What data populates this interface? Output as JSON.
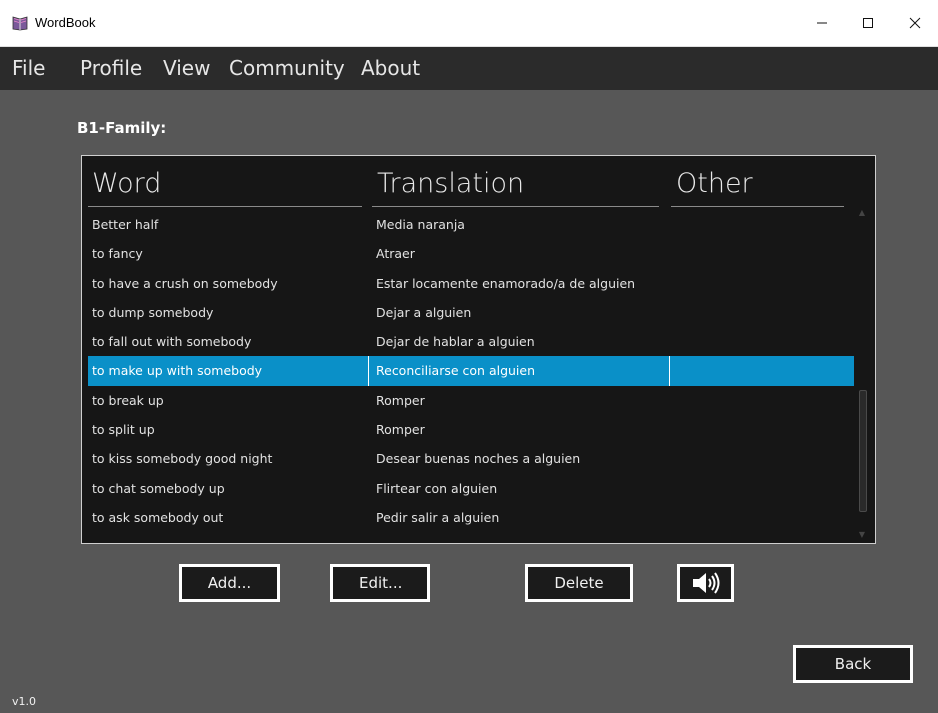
{
  "window": {
    "title": "WordBook",
    "app_icon": "book-icon",
    "controls": {
      "minimize": "minimize-icon",
      "maximize": "maximize-icon",
      "close": "close-icon"
    }
  },
  "menu": {
    "items": [
      {
        "label": "File"
      },
      {
        "label": "Profile"
      },
      {
        "label": "View"
      },
      {
        "label": "Community"
      },
      {
        "label": "About"
      }
    ]
  },
  "section": {
    "title": "B1-Family:"
  },
  "table": {
    "columns": [
      {
        "label": "Word"
      },
      {
        "label": "Translation"
      },
      {
        "label": "Other"
      }
    ],
    "rows": [
      {
        "word": "Better half",
        "translation": "Media naranja",
        "other": "",
        "selected": false
      },
      {
        "word": "to fancy",
        "translation": "Atraer",
        "other": "",
        "selected": false
      },
      {
        "word": "to have a crush on somebody",
        "translation": "Estar locamente enamorado/a de alguien",
        "other": "",
        "selected": false
      },
      {
        "word": "to dump somebody",
        "translation": "Dejar a alguien",
        "other": "",
        "selected": false
      },
      {
        "word": "to fall out with somebody",
        "translation": "Dejar de hablar a alguien",
        "other": "",
        "selected": false
      },
      {
        "word": "to make up with somebody",
        "translation": "Reconciliarse con alguien",
        "other": "",
        "selected": true
      },
      {
        "word": "to break up",
        "translation": "Romper",
        "other": "",
        "selected": false
      },
      {
        "word": "to split up",
        "translation": "Romper",
        "other": "",
        "selected": false
      },
      {
        "word": "to kiss somebody good night",
        "translation": "Desear buenas noches a alguien",
        "other": "",
        "selected": false
      },
      {
        "word": "to chat somebody up",
        "translation": "Flirtear con alguien",
        "other": "",
        "selected": false
      },
      {
        "word": "to ask somebody out",
        "translation": "Pedir salir a alguien",
        "other": "",
        "selected": false
      }
    ]
  },
  "buttons": {
    "add": "Add...",
    "edit": "Edit...",
    "delete": "Delete",
    "speaker_icon": "speaker-icon",
    "back": "Back"
  },
  "footer": {
    "version": "v1.0"
  },
  "colors": {
    "background": "#575757",
    "menubar": "#2b2b2b",
    "table_bg": "#161616",
    "selection": "#0a90c8"
  }
}
